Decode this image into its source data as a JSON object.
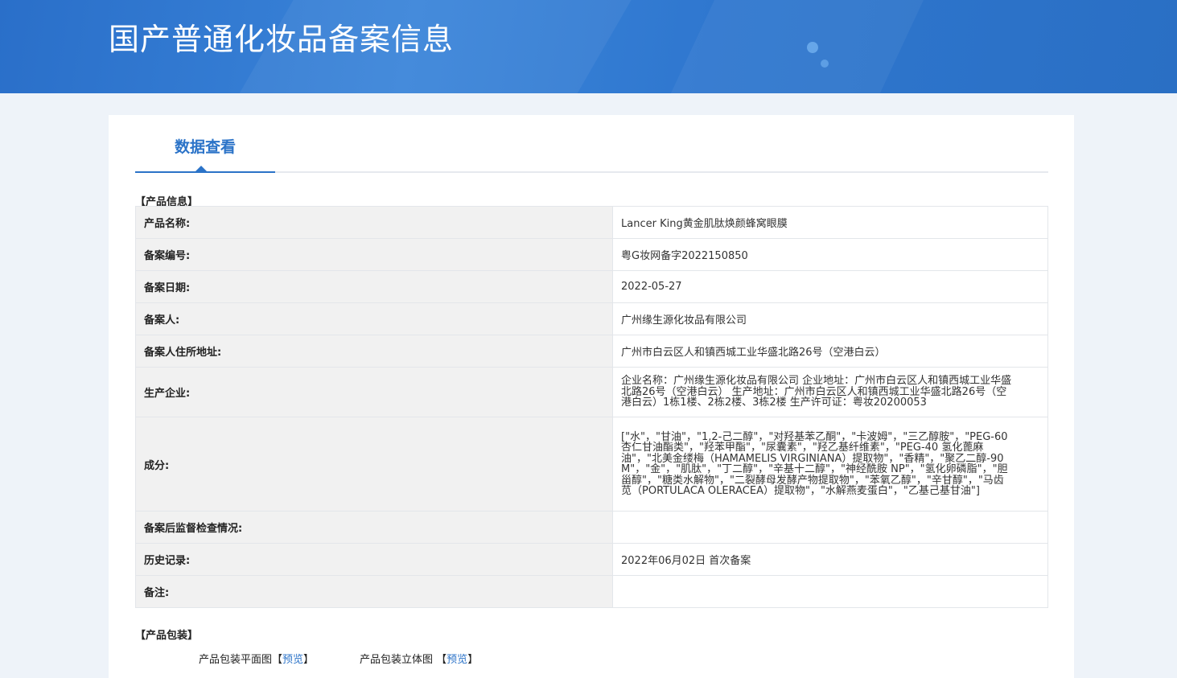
{
  "header": {
    "title": "国产普通化妆品备案信息"
  },
  "tabs": [
    {
      "label": "数据查看"
    }
  ],
  "sections": {
    "product_info": "【产品信息】",
    "product_package": "【产品包装】"
  },
  "product": {
    "rows": [
      {
        "key": "产品名称:",
        "value": "Lancer King黄金肌肽焕颜蜂窝眼膜"
      },
      {
        "key": "备案编号:",
        "value": "粤G妆网备字2022150850"
      },
      {
        "key": "备案日期:",
        "value": "2022-05-27"
      },
      {
        "key": "备案人:",
        "value": "广州缘生源化妆品有限公司"
      },
      {
        "key": "备案人住所地址:",
        "value": "广州市白云区人和镇西城工业华盛北路26号（空港白云）"
      },
      {
        "key": "生产企业:",
        "value": "企业名称：广州缘生源化妆品有限公司 企业地址：广州市白云区人和镇西城工业华盛北路26号（空港白云） 生产地址：广州市白云区人和镇西城工业华盛北路26号（空港白云）1栋1楼、2栋2楼、3栋2楼 生产许可证：粤妆20200053"
      },
      {
        "key": "成分:",
        "value": "[\"水\"，\"甘油\"，\"1,2-己二醇\"，\"对羟基苯乙酮\"，\"卡波姆\"，\"三乙醇胺\"，\"PEG-60 杏仁甘油酯类\"，\"羟苯甲酯\"，\"尿囊素\"，\"羟乙基纤维素\"，\"PEG-40 氢化蓖麻油\"，\"北美金缕梅（HAMAMELIS VIRGINIANA）提取物\"，\"香精\"，\"聚乙二醇-90M\"，\"金\"，\"肌肽\"，\"丁二醇\"，\"辛基十二醇\"，\"神经酰胺 NP\"，\"氢化卵磷脂\"，\"胆甾醇\"，\"糖类水解物\"，\"二裂酵母发酵产物提取物\"，\"苯氧乙醇\"，\"辛甘醇\"，\"马齿苋（PORTULACA OLERACEA）提取物\"，\"水解燕麦蛋白\"，\"乙基己基甘油\"]"
      },
      {
        "key": "备案后监督检查情况:",
        "value": ""
      },
      {
        "key": "历史记录:",
        "value": "2022年06月02日 首次备案"
      },
      {
        "key": "备注:",
        "value": ""
      }
    ]
  },
  "package": {
    "flat_label": "产品包装平面图",
    "solid_label": "产品包装立体图",
    "bracket_open": "【",
    "bracket_close": "】",
    "preview_label": "预览"
  },
  "colors": {
    "banner": "#2f77cf",
    "accent": "#2b73c8",
    "key_bg": "#f1f1f1"
  }
}
